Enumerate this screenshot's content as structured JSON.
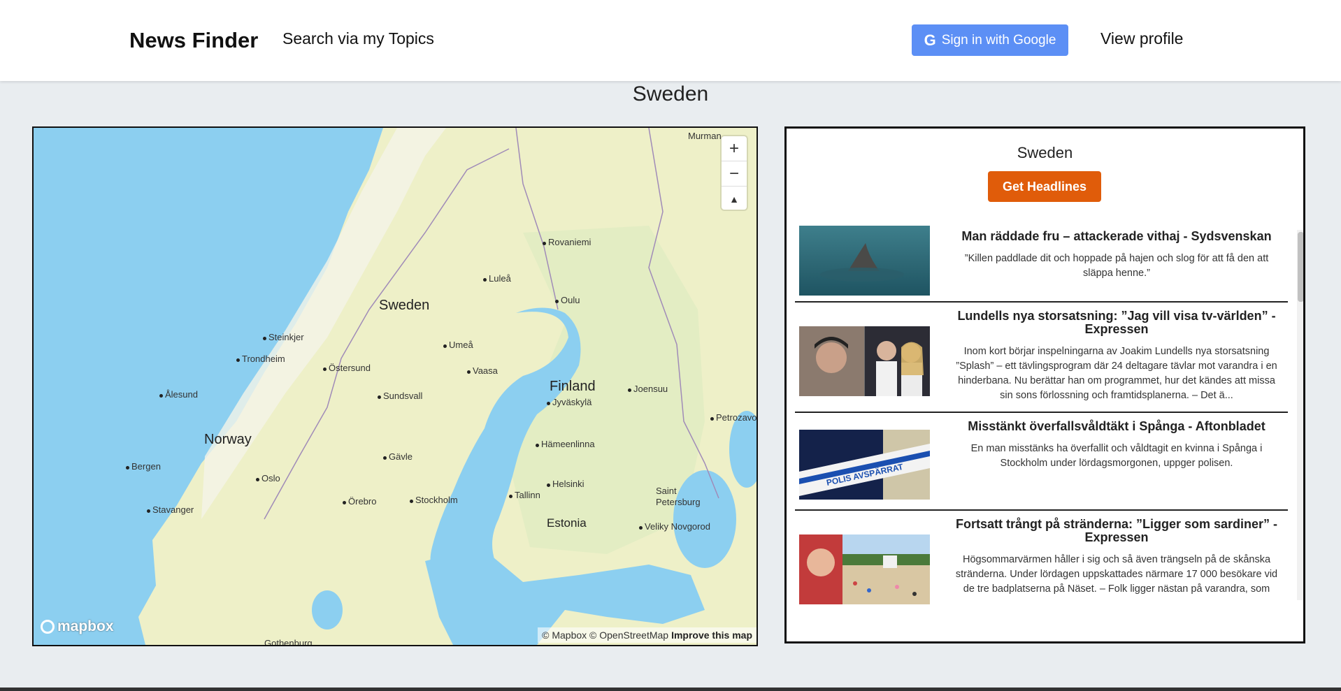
{
  "header": {
    "brand": "News Finder",
    "topics_link": "Search via my Topics",
    "google_button": "Sign in with Google",
    "google_glyph": "G",
    "view_profile": "View profile"
  },
  "page_title": "Sweden",
  "map": {
    "labels": {
      "murmansk": "Murman",
      "rovaniemi": "Rovaniemi",
      "lulea": "Luleå",
      "oulu": "Oulu",
      "sweden": "Sweden",
      "steinkjer": "Steinkjer",
      "umea": "Umeå",
      "trondheim": "Trondheim",
      "ostersund": "Östersund",
      "vaasa": "Vaasa",
      "finland": "Finland",
      "joensuu": "Joensuu",
      "alesund": "Ålesund",
      "sundsvall": "Sundsvall",
      "jyvaskyla": "Jyväskylä",
      "petrozavod": "Petrozavod",
      "norway": "Norway",
      "hameenlinna": "Hämeenlinna",
      "bergen": "Bergen",
      "gavle": "Gävle",
      "oslo": "Oslo",
      "helsinki": "Helsinki",
      "saint": "Saint",
      "petersburg": "Petersburg",
      "tallinn": "Tallinn",
      "orebro": "Örebro",
      "stockholm": "Stockholm",
      "stavanger": "Stavanger",
      "estonia": "Estonia",
      "novgorod": "Veliky Novgorod",
      "gothenburg": "Gothenburg"
    },
    "zoom_in": "+",
    "zoom_out": "−",
    "compass": "▲",
    "logo_text": "mapbox",
    "attribution": "© Mapbox © OpenStreetMap",
    "improve": "Improve this map",
    "colors": {
      "water": "#8ccff0",
      "land": "#eef0c8",
      "mountains": "#f4f4e8",
      "forest": "#e0ecc2"
    }
  },
  "panel": {
    "title": "Sweden",
    "get_headlines": "Get Headlines",
    "articles": [
      {
        "title": "Man räddade fru – attackerade vithaj - Sydsvenskan",
        "desc": "”Killen paddlade dit och hoppade på hajen och slog för att få den att släppa henne.”"
      },
      {
        "title": "Lundells nya storsatsning: ”Jag vill visa tv-världen” - Expressen",
        "desc": "Inom kort börjar inspelningarna av Joakim Lundells nya storsatsning ”Splash” – ett tävlingsprogram där 24 deltagare tävlar mot varandra i en hinderbana. Nu berättar han om programmet, hur det kändes att missa sin sons förlossning och framtidsplanerna. – Det ä..."
      },
      {
        "title": "Misstänkt överfallsvåldtäkt i Spånga - Aftonbladet",
        "desc": "En man misstänks ha överfallit och våldtagit en kvinna i Spånga i Stockholm under lördagsmorgonen, uppger polisen."
      },
      {
        "title": "Fortsatt trångt på stränderna: ”Ligger som sardiner” - Expressen",
        "desc": "Högsommarvärmen håller i sig och så även trängseln på de skånska stränderna. Under lördagen uppskattades närmare 17 000 besökare vid de tre badplatserna på Näset. – Folk ligger nästan på varandra, som"
      }
    ],
    "tape_text": "POLIS AVSPÄRRAT"
  }
}
